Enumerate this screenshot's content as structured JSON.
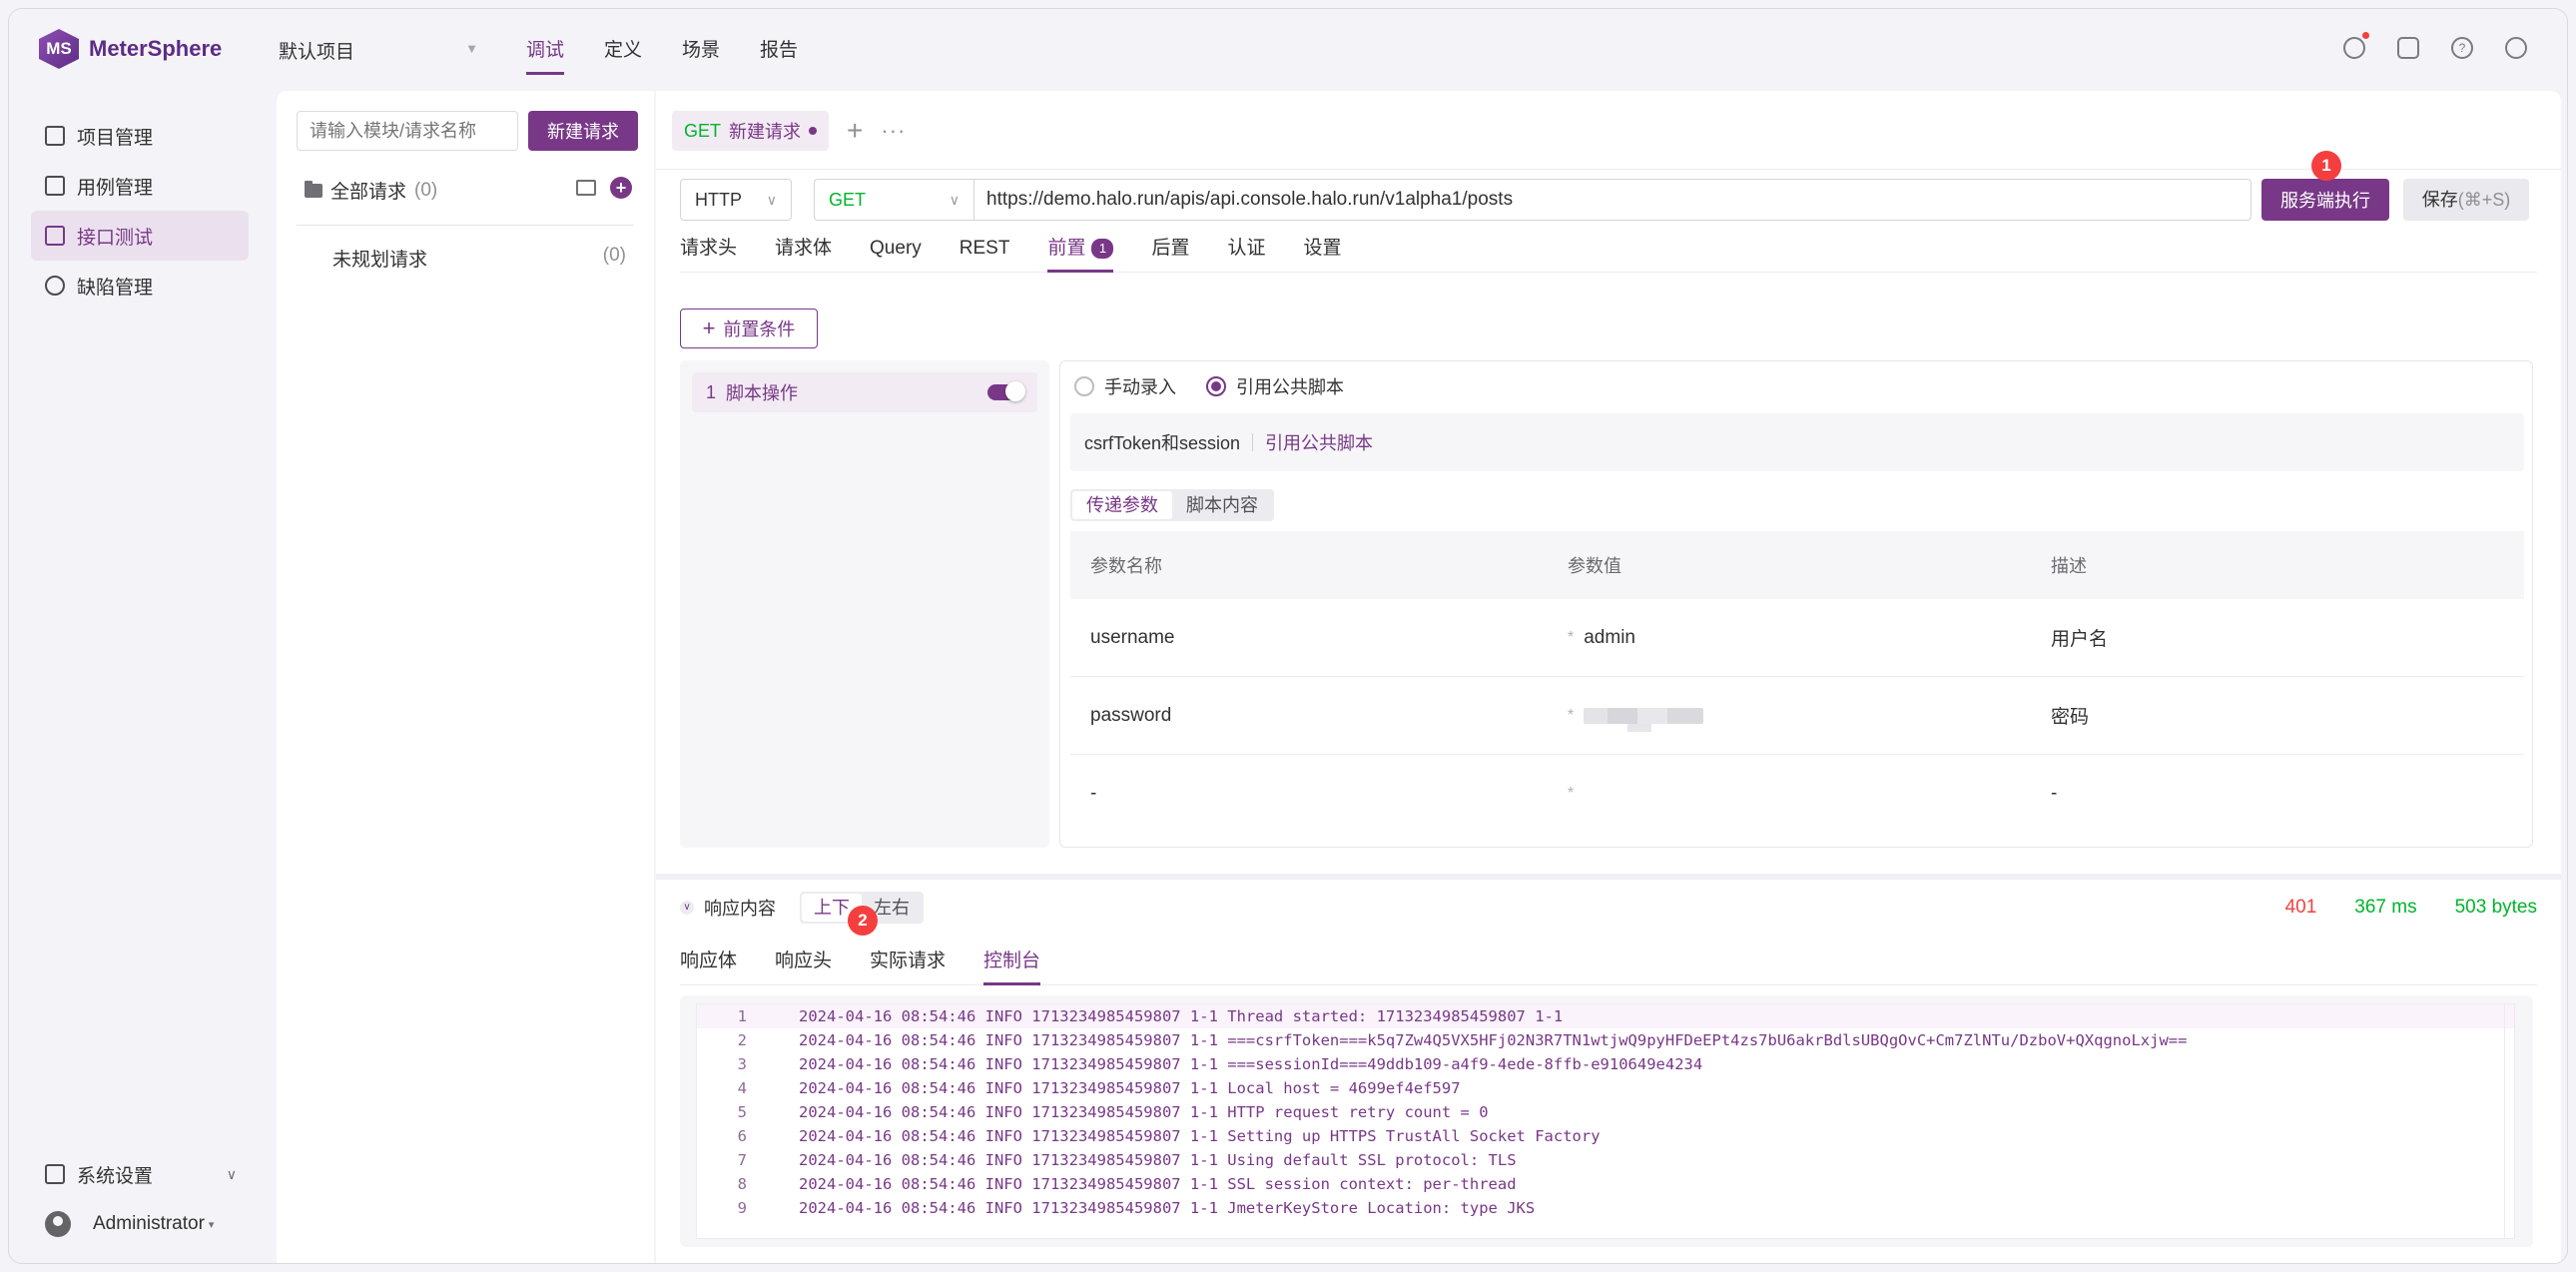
{
  "app": {
    "logo_text": "MeterSphere",
    "logo_mark": "MS",
    "project": "默认项目",
    "nav": [
      "调试",
      "定义",
      "场景",
      "报告"
    ],
    "nav_active_index": 0
  },
  "top_icons": [
    "bell-icon",
    "task-icon",
    "help-icon",
    "user-settings-icon"
  ],
  "sidebar": {
    "items": [
      {
        "label": "项目管理",
        "icon": "project-icon"
      },
      {
        "label": "用例管理",
        "icon": "case-icon"
      },
      {
        "label": "接口测试",
        "icon": "api-test-icon",
        "active": true
      },
      {
        "label": "缺陷管理",
        "icon": "bug-icon"
      }
    ],
    "settings_label": "系统设置",
    "user_label": "Administrator"
  },
  "module_panel": {
    "search_placeholder": "请输入模块/请求名称",
    "new_request_label": "新建请求",
    "all_requests_label": "全部请求",
    "all_requests_count": "(0)",
    "unplanned_label": "未规划请求",
    "unplanned_count": "(0)"
  },
  "request_tab": {
    "method": "GET",
    "name": "新建请求",
    "add_symbol": "+",
    "more_symbol": "···"
  },
  "url_bar": {
    "protocol": "HTTP",
    "method": "GET",
    "url": "https://demo.halo.run/apis/api.console.halo.run/v1alpha1/posts",
    "server_run_label": "服务端执行",
    "save_label": "保存",
    "save_shortcut": "(⌘+S)",
    "badge_1": "1"
  },
  "sub_tabs": [
    {
      "label": "请求头"
    },
    {
      "label": "请求体"
    },
    {
      "label": "Query"
    },
    {
      "label": "REST"
    },
    {
      "label": "前置",
      "badge": "1",
      "active": true
    },
    {
      "label": "后置"
    },
    {
      "label": "认证"
    },
    {
      "label": "设置"
    }
  ],
  "pre": {
    "add_condition_label": "前置条件",
    "step_index": "1",
    "step_label": "脚本操作",
    "step_enabled": true,
    "radio_manual": "手动录入",
    "radio_public": "引用公共脚本",
    "radio_selected": "public",
    "script_name": "csrfToken和session",
    "script_link": "引用公共脚本",
    "seg_params": "传递参数",
    "seg_content": "脚本内容",
    "table": {
      "headers": [
        "参数名称",
        "参数值",
        "描述"
      ],
      "rows": [
        {
          "name": "username",
          "star": "*",
          "value": "admin",
          "desc": "用户名"
        },
        {
          "name": "password",
          "star": "*",
          "value": "",
          "masked": true,
          "desc": "密码"
        },
        {
          "name": "-",
          "star": "*",
          "value": "",
          "desc": "-"
        }
      ]
    }
  },
  "response": {
    "title": "响应内容",
    "layout_vertical": "上下",
    "layout_horizontal": "左右",
    "status": "401",
    "time": "367 ms",
    "size": "503 bytes",
    "tabs": [
      "响应体",
      "响应头",
      "实际请求",
      "控制台"
    ],
    "active_tab_index": 3,
    "badge_2": "2",
    "console_lines": [
      {
        "n": "1",
        "t": "2024-04-16 08:54:46 INFO 1713234985459807 1-1 Thread started: 1713234985459807 1-1"
      },
      {
        "n": "2",
        "t": "2024-04-16 08:54:46 INFO 1713234985459807 1-1 ===csrfToken===k5q7Zw4Q5VX5HFj02N3R7TN1wtjwQ9pyHFDeEPt4zs7bU6akrBdlsUBQgOvC+Cm7ZlNTu/DzboV+QXqgnoLxjw=="
      },
      {
        "n": "3",
        "t": "2024-04-16 08:54:46 INFO 1713234985459807 1-1 ===sessionId===49ddb109-a4f9-4ede-8ffb-e910649e4234"
      },
      {
        "n": "4",
        "t": "2024-04-16 08:54:46 INFO 1713234985459807 1-1 Local host = 4699ef4ef597"
      },
      {
        "n": "5",
        "t": "2024-04-16 08:54:46 INFO 1713234985459807 1-1 HTTP request retry count = 0"
      },
      {
        "n": "6",
        "t": "2024-04-16 08:54:46 INFO 1713234985459807 1-1 Setting up HTTPS TrustAll Socket Factory"
      },
      {
        "n": "7",
        "t": "2024-04-16 08:54:46 INFO 1713234985459807 1-1 Using default SSL protocol: TLS"
      },
      {
        "n": "8",
        "t": "2024-04-16 08:54:46 INFO 1713234985459807 1-1 SSL session context: per-thread"
      },
      {
        "n": "9",
        "t": "2024-04-16 08:54:46 INFO 1713234985459807 1-1 JmeterKeyStore Location:  type JKS"
      }
    ]
  },
  "colors": {
    "primary": "#783887",
    "success": "#00b42a",
    "danger": "#f53f3f"
  }
}
